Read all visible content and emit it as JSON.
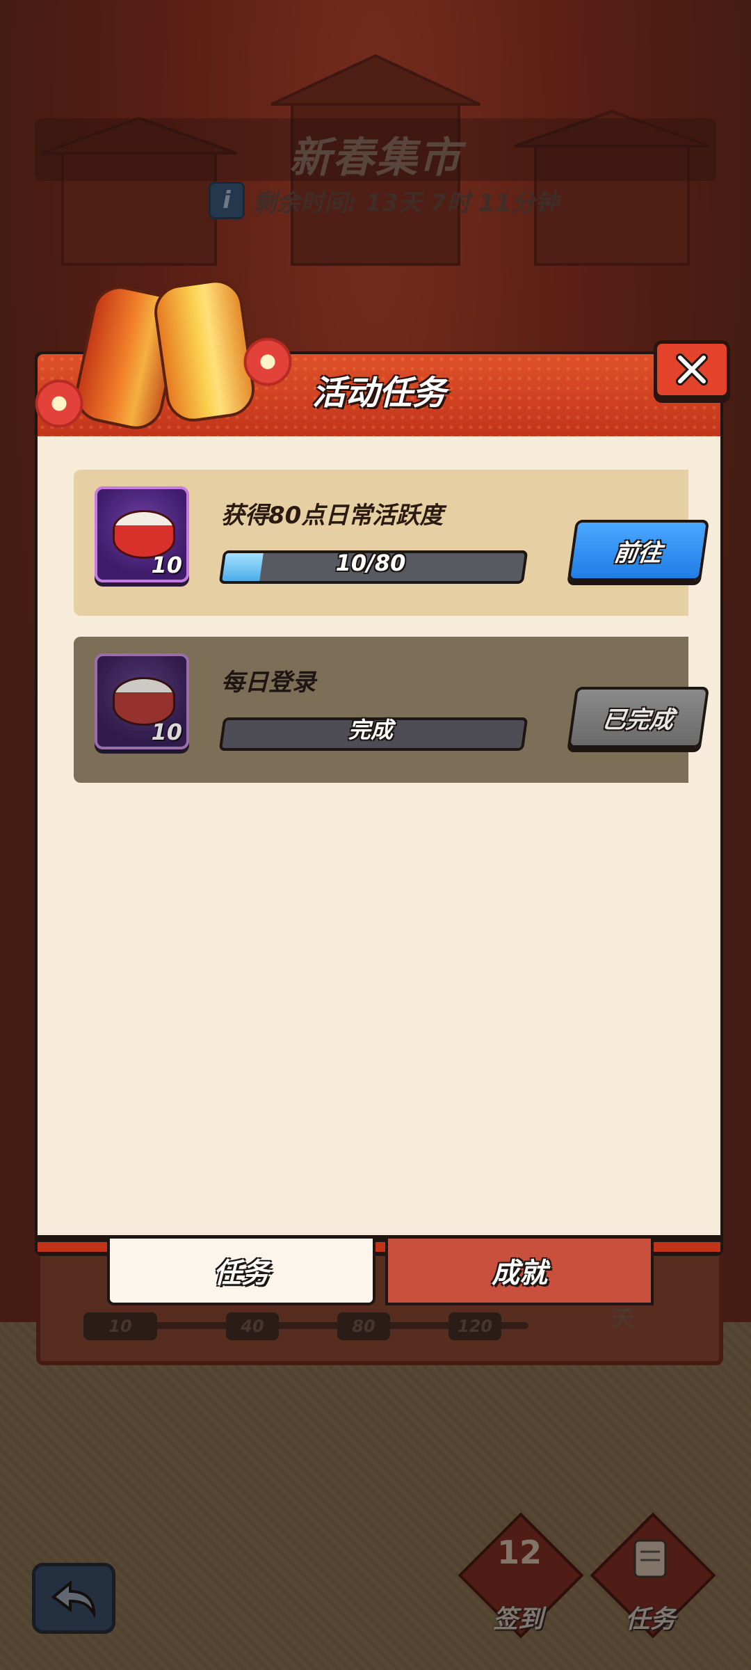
{
  "background": {
    "event_title": "新春集市",
    "timer_label": "剩余时间: 13天 7时 11分钟",
    "milestones": [
      "10",
      "40",
      "80",
      "120"
    ],
    "streak_suffix": "天"
  },
  "modal": {
    "title": "活动任务",
    "tasks": [
      {
        "name": "获得80点日常活跃度",
        "reward_count": "10",
        "progress_text": "10/80",
        "progress_fraction": 0.125,
        "button_label": "前往",
        "state": "active"
      },
      {
        "name": "每日登录",
        "reward_count": "10",
        "progress_text": "完成",
        "progress_fraction": 0,
        "button_label": "已完成",
        "state": "done"
      }
    ],
    "tabs": [
      {
        "label": "任务",
        "active": true
      },
      {
        "label": "成就",
        "active": false
      }
    ]
  },
  "bottom_bar": {
    "checkin_label": "签到",
    "checkin_day": "12",
    "tasks_label": "任务"
  },
  "colors": {
    "header_red": "#d9452a",
    "body_cream": "#f7ebd9",
    "go_button_blue": "#2b8df0",
    "done_button_gray": "#7a7a7a",
    "progress_blue": "#5fc0f2"
  }
}
